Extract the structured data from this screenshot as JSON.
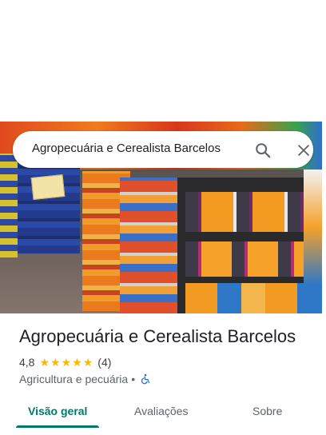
{
  "search": {
    "query": "Agropecuária e Cerealista Barcelos"
  },
  "place": {
    "name": "Agropecuária e Cerealista Barcelos",
    "rating": "4,8",
    "rating_value": 4.8,
    "stars": 5,
    "review_count": "(4)",
    "category": "Agricultura e pecuária",
    "separator": "•"
  },
  "tabs": [
    {
      "label": "Visão geral",
      "active": true
    },
    {
      "label": "Avaliações",
      "active": false
    },
    {
      "label": "Sobre",
      "active": false
    }
  ],
  "colors": {
    "accent": "#00796b",
    "star": "#f9b900",
    "accessibility": "#1a73e8"
  },
  "icons": {
    "search": "search-icon",
    "close": "close-icon",
    "accessibility": "wheelchair-icon",
    "star": "star-icon"
  }
}
